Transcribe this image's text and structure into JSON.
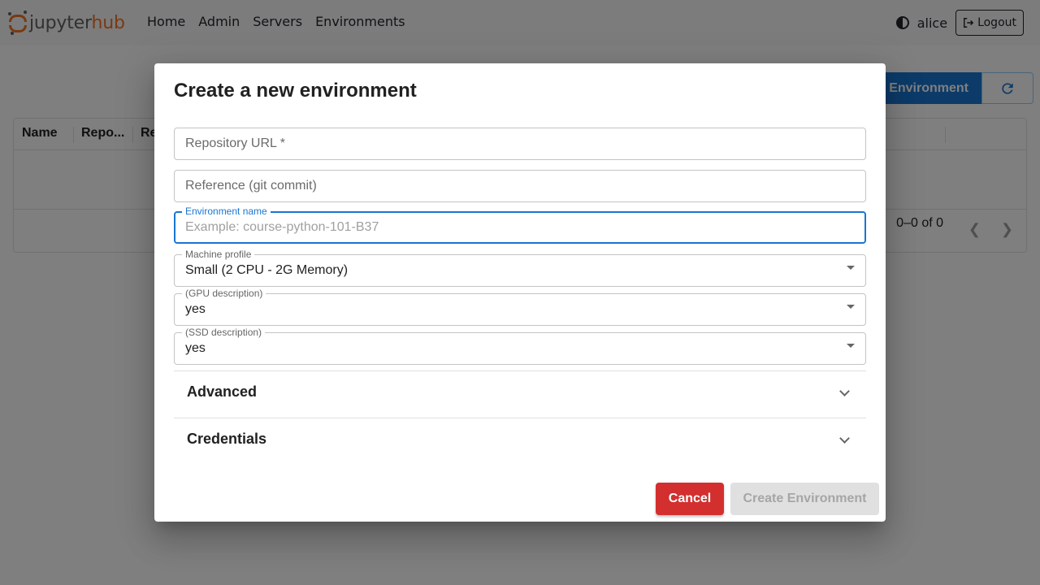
{
  "navbar": {
    "logo_text_1": "jupyter",
    "logo_text_2": "hub",
    "links": [
      "Home",
      "Admin",
      "Servers",
      "Environments"
    ],
    "username": "alice",
    "logout_label": "Logout"
  },
  "page": {
    "create_button_label": "Environment",
    "grid_columns": [
      "Name",
      "Repo...",
      "Re"
    ],
    "pager_text": "0–0 of 0"
  },
  "dialog": {
    "title": "Create a new environment",
    "repo_url_placeholder": "Repository URL *",
    "reference_placeholder": "Reference (git commit)",
    "env_name_label": "Environment name",
    "env_name_placeholder": "Example: course-python-101-B37",
    "machine_profile_label": "Machine profile",
    "machine_profile_value": "Small (2 CPU - 2G Memory)",
    "gpu_label": "(GPU description)",
    "gpu_value": "yes",
    "ssd_label": "(SSD description)",
    "ssd_value": "yes",
    "advanced_label": "Advanced",
    "credentials_label": "Credentials",
    "cancel_label": "Cancel",
    "create_label": "Create Environment"
  },
  "colors": {
    "primary": "#1976d2",
    "danger": "#d32f2f",
    "brand_orange": "#f37524",
    "disabled_bg": "#e0e0e0"
  }
}
